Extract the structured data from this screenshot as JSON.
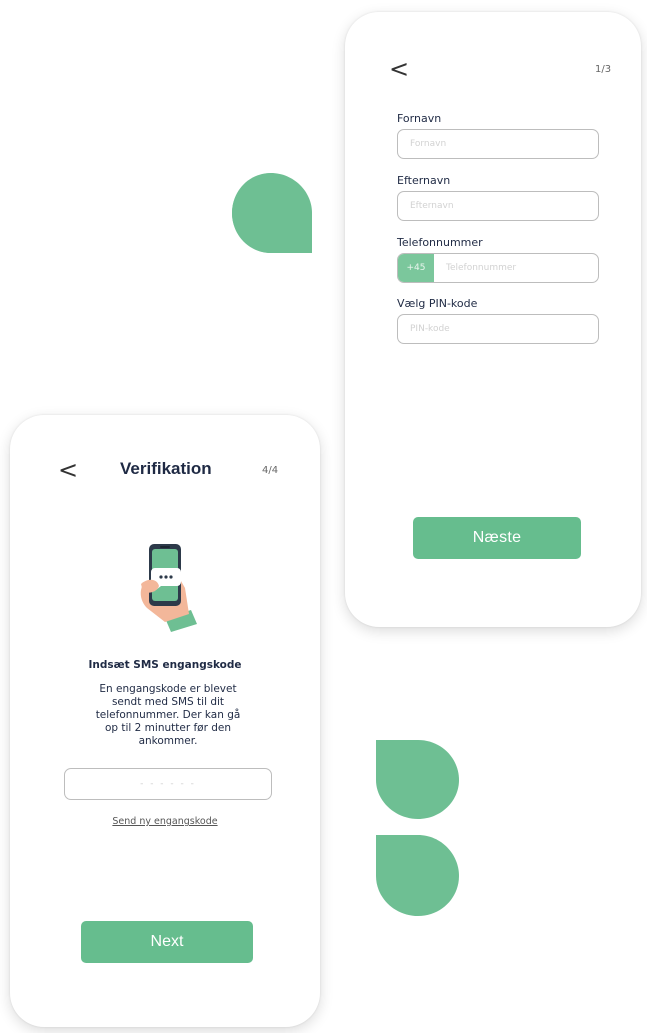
{
  "colors": {
    "brand_green": "#66bd8e",
    "shape_green": "#6ebf93",
    "text_dark": "#1f2a44"
  },
  "registration_screen": {
    "back_icon": "chevron-left-icon",
    "back_glyph": "<",
    "step": "1/3",
    "fields": [
      {
        "label": "Fornavn",
        "placeholder": "Fornavn"
      },
      {
        "label": "Efternavn",
        "placeholder": "Efternavn"
      },
      {
        "label": "Telefonnummer",
        "prefix": "+45",
        "placeholder": "Telefonnummer"
      },
      {
        "label": "Vælg PIN-kode",
        "placeholder": "PIN-kode"
      }
    ],
    "next_label": "Næste"
  },
  "verification_screen": {
    "back_icon": "chevron-left-icon",
    "back_glyph": "<",
    "title": "Verifikation",
    "step": "4/4",
    "illustration": "phone-in-hand-sms-icon",
    "heading": "Indsæt SMS engangskode",
    "body": "En engangskode er blevet sendt med SMS til dit telefonnummer. Der kan gå op til 2 minutter før den ankommer.",
    "code_placeholder": "- - - - - -",
    "resend_label": "Send ny engangskode",
    "next_label": "Next"
  }
}
